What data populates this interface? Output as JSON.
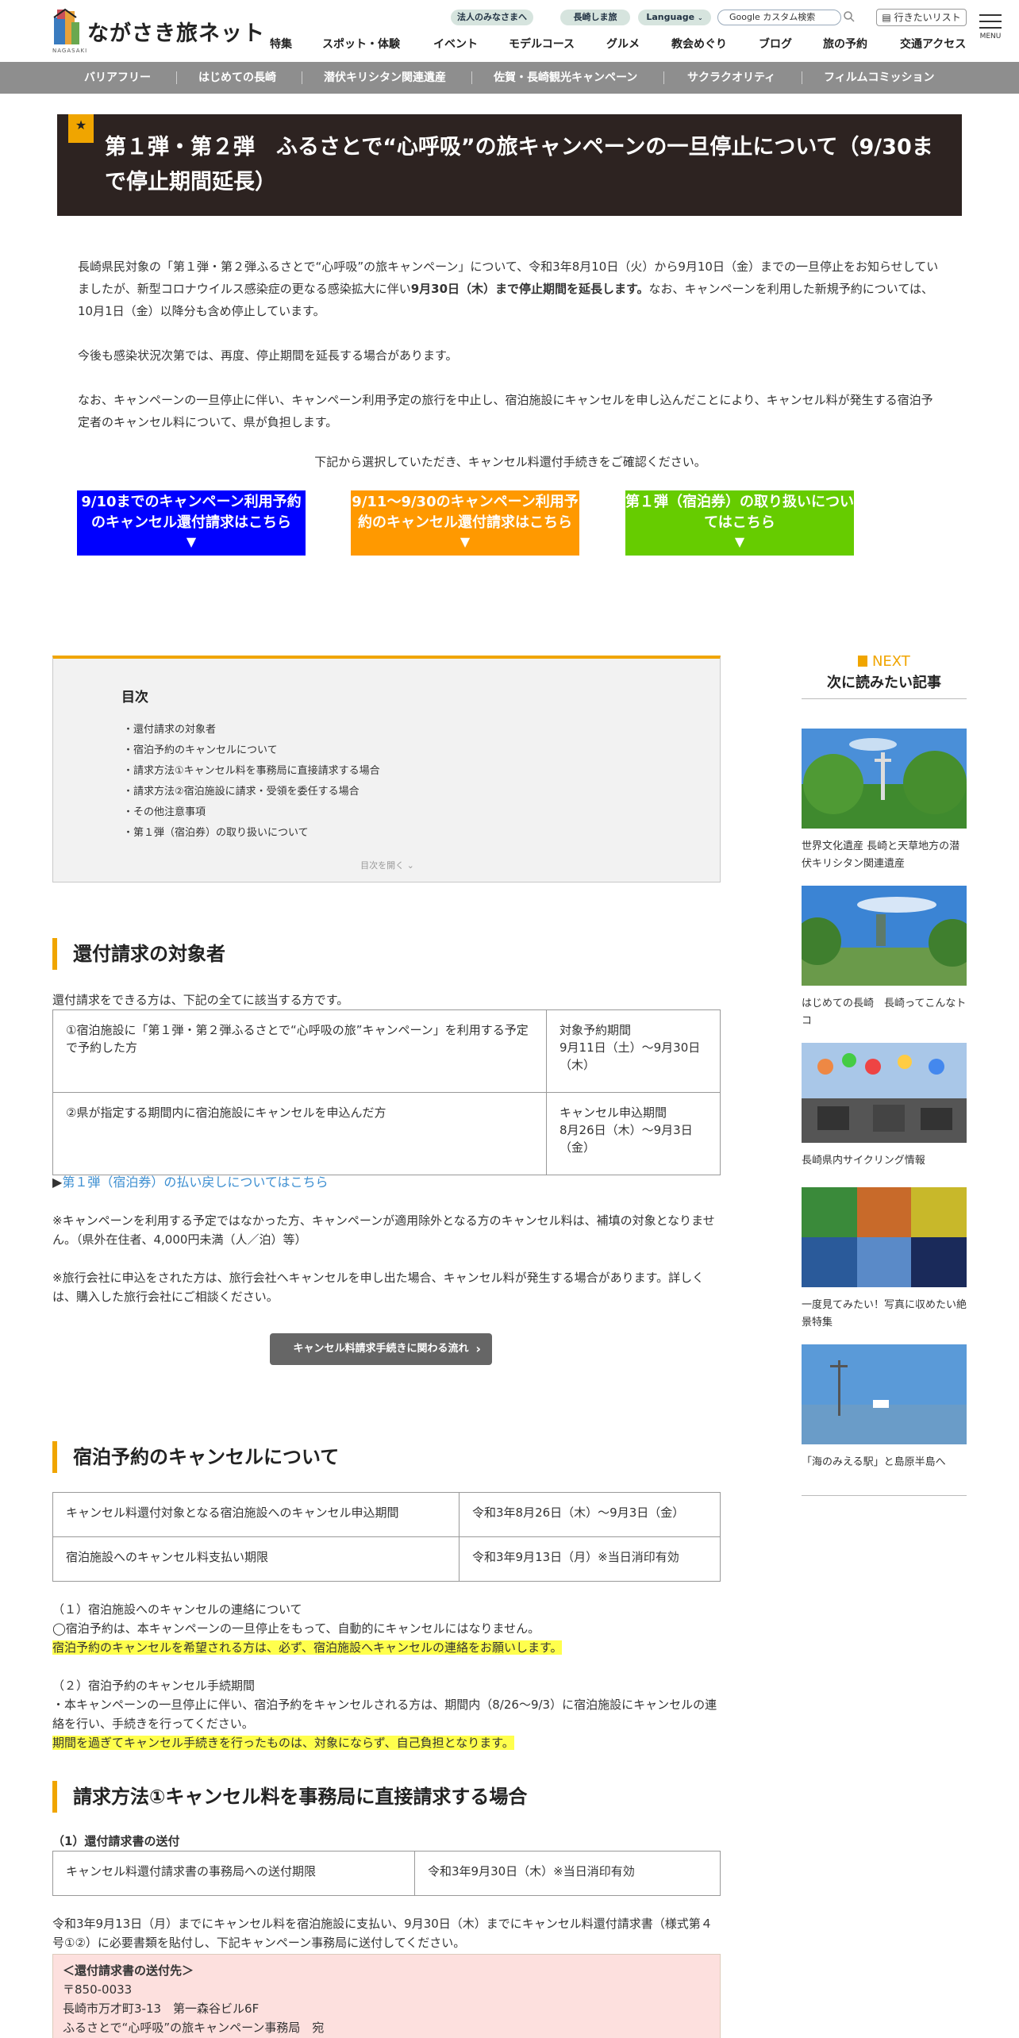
{
  "header": {
    "logo_text": "ながさき旅ネット",
    "logo_sub": "NAGASAKI",
    "pills": [
      "法人のみなさまへ",
      "長崎しま旅",
      "Language"
    ],
    "search_placeholder": "Google カスタム検索",
    "visit_list": "行きたいリスト",
    "menu_label": "MENU",
    "nav": [
      "特集",
      "スポット・体験",
      "イベント",
      "モデルコース",
      "グルメ",
      "教会めぐり",
      "ブログ",
      "旅の予約",
      "交通アクセス"
    ]
  },
  "subnav": [
    "バリアフリー",
    "はじめての長崎",
    "潜伏キリシタン関連遺産",
    "佐賀・長崎観光キャンペーン",
    "サクラクオリティ",
    "フィルムコミッション"
  ],
  "title": "第１弾・第２弾　ふるさとで“心呼吸”の旅キャンペーンの一旦停止について（9/30まで停止期間延長）",
  "intro": {
    "p1_a": "長崎県民対象の「第１弾・第２弾ふるさとで“心呼吸”の旅キャンペーン」について、令和3年8月10日（火）から9月10日（金）までの一旦停止をお知らせしていましたが、新型コロナウイルス感染症の更なる感染拡大に伴い",
    "p1_bold": "9月30日（木）まで停止期間を延長します。",
    "p1_b": "なお、キャンペーンを利用した新規予約については、10月1日（金）以降分も含め停止しています。",
    "p2": "今後も感染状況次第では、再度、停止期間を延長する場合があります。",
    "p3": "なお、キャンペーンの一旦停止に伴い、キャンペーン利用予定の旅行を中止し、宿泊施設にキャンセルを申し込んだことにより、キャンセル料が発生する宿泊予定者のキャンセル料について、県が負担します。",
    "p4": "下記から選択していただき、キャンセル料還付手続きをご確認ください。"
  },
  "cta": [
    {
      "label": "9/10までのキャンペーン利用予約のキャンセル還付請求はこちら",
      "color": "#0000ff"
    },
    {
      "label": "9/11～9/30のキャンペーン利用予約のキャンセル還付請求はこちら",
      "color": "#ff9900"
    },
    {
      "label": "第１弾（宿泊券）の取り扱いについてはこちら",
      "color": "#66cc00"
    }
  ],
  "toc": {
    "title": "目次",
    "items": [
      "・還付請求の対象者",
      "・宿泊予約のキャンセルについて",
      "・請求方法①キャンセル料を事務局に直接請求する場合",
      "・請求方法②宿泊施設に請求・受領を委任する場合",
      "・その他注意事項",
      "・第１弾（宿泊券）の取り扱いについて"
    ],
    "more": "目次を開く"
  },
  "sec1": {
    "heading": "還付請求の対象者",
    "lead": "還付請求をできる方は、下記の全てに該当する方です。",
    "rows": [
      {
        "cond": "①宿泊施設に「第１弾・第２弾ふるさとで“心呼吸の旅”キャンペーン」を利用する予定で予約した方",
        "period_label": "対象予約期間",
        "period": "9月11日（土）～9月30日（木）"
      },
      {
        "cond": "②県が指定する期間内に宿泊施設にキャンセルを申込んだ方",
        "period_label": "キャンセル申込期間",
        "period": "8月26日（木）～9月3日（金）"
      }
    ],
    "link_mark": "▶",
    "link": "第１弾（宿泊券）の払い戻しについてはこちら",
    "note1": "※キャンペーンを利用する予定ではなかった方、キャンペーンが適用除外となる方のキャンセル料は、補填の対象となりません。（県外在住者、4,000円未満（人／泊）等）",
    "note2": "※旅行会社に申込をされた方は、旅行会社へキャンセルを申し出た場合、キャンセル料が発生する場合があります。詳しくは、購入した旅行会社にご相談ください。",
    "button": "キャンセル料請求手続きに関わる流れ"
  },
  "sec2": {
    "heading": "宿泊予約のキャンセルについて",
    "rows": [
      {
        "k": "キャンセル料還付対象となる宿泊施設へのキャンセル申込期間",
        "v": "令和3年8月26日（木）～9月3日（金）"
      },
      {
        "k": "宿泊施設へのキャンセル料支払い期限",
        "v": "令和3年9月13日（月）※当日消印有効"
      }
    ],
    "s1_title": "（１）宿泊施設へのキャンセルの連絡について",
    "s1_text": "◯宿泊予約は、本キャンペーンの一旦停止をもって、自動的にキャンセルにはなりません。",
    "s1_hl": "宿泊予約のキャンセルを希望される方は、必ず、宿泊施設へキャンセルの連絡をお願いします。",
    "s2_title": "（２）宿泊予約のキャンセル手続期間",
    "s2_text": "・本キャンペーンの一旦停止に伴い、宿泊予約をキャンセルされる方は、期間内（8/26～9/3）に宿泊施設にキャンセルの連絡を行い、手続きを行ってください。",
    "s2_hl": "期間を過ぎてキャンセル手続きを行ったものは、対象にならず、自己負担となります。"
  },
  "sec3": {
    "heading": "請求方法①キャンセル料を事務局に直接請求する場合",
    "sub": "（1）還付請求書の送付",
    "row": {
      "k": "キャンセル料還付請求書の事務局への送付期限",
      "v": "令和3年9月30日（木）※当日消印有効"
    },
    "text": "令和3年9月13日（月）までにキャンセル料を宿泊施設に支払い、9月30日（木）までにキャンセル料還付請求書（様式第４号①②）に必要書類を貼付し、下記キャンペーン事務局に送付してください。",
    "box_title": "＜還付請求書の送付先＞",
    "box_lines": [
      "〒850-0033",
      "長崎市万才町3-13　第一森谷ビル6F",
      "ふるさとで“心呼吸”の旅キャンペーン事務局　宛"
    ]
  },
  "sidebar": {
    "next_label": "NEXT",
    "next_title": "次に読みたい記事",
    "cards": [
      "世界文化遺産 長崎と天草地方の潜伏キリシタン関連遺産",
      "はじめての長崎　長崎ってこんなトコ",
      "長崎県内サイクリング情報",
      "一度見てみたい！写真に収めたい絶景特集",
      "「海のみえる駅」と島原半島へ"
    ]
  },
  "colors": {
    "accent": "#f0a500",
    "title_bg": "#2d2321",
    "link": "#3d8fd1",
    "highlight": "#ffff4d"
  }
}
